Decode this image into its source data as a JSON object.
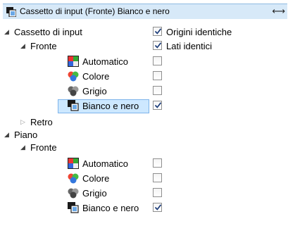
{
  "dropdown": {
    "title": "Cassetto di input (Fronte) Bianco e nero",
    "icon": "black-white-mode-icon"
  },
  "tree": {
    "cassetto": "Cassetto di input",
    "fronte1": "Fronte",
    "retro": "Retro",
    "piano": "Piano",
    "fronte2": "Fronte",
    "modes1": [
      "Automatico",
      "Colore",
      "Grigio",
      "Bianco e nero"
    ],
    "modes2": [
      "Automatico",
      "Colore",
      "Grigio",
      "Bianco e nero"
    ],
    "selected": "Bianco e nero"
  },
  "options": {
    "origini": "Origini identiche",
    "lati": "Lati identici",
    "origini_checked": true,
    "lati_checked": true
  },
  "checks1": {
    "automatico": false,
    "colore": false,
    "grigio": false,
    "bianco_nero": true
  },
  "checks2": {
    "automatico": false,
    "colore": false,
    "grigio": false,
    "bianco_nero": true
  }
}
